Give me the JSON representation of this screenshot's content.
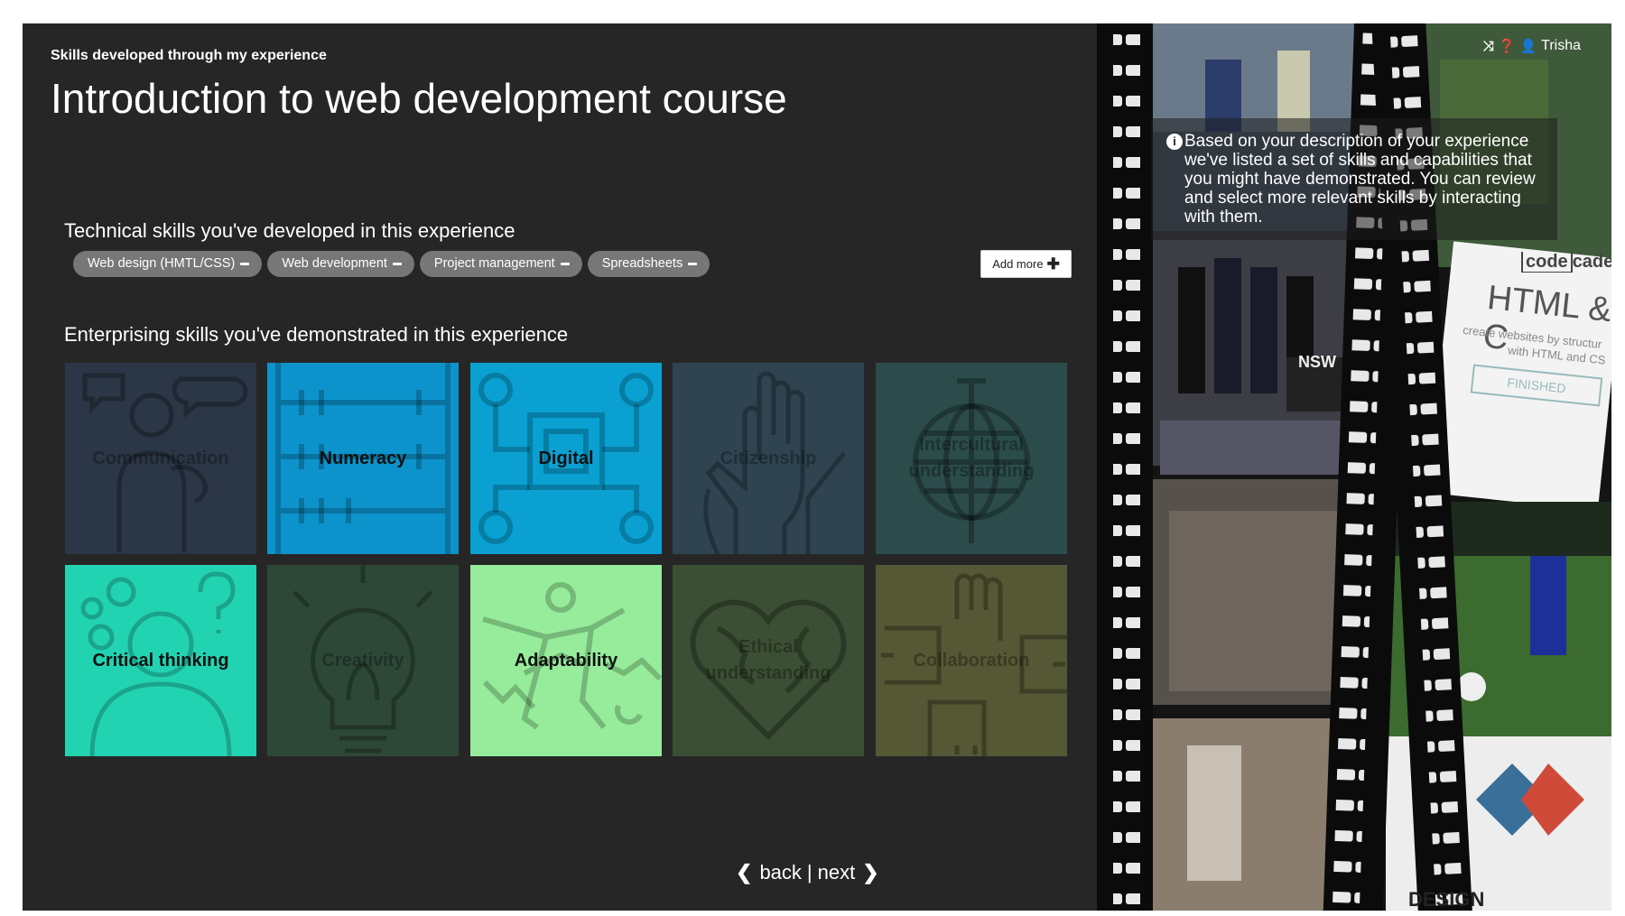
{
  "page": {
    "kicker": "Skills developed through my experience",
    "title": "Introduction to web development course"
  },
  "technical": {
    "heading": "Technical skills you've developed in this experience",
    "chips": [
      {
        "label": "Web design (HMTL/CSS)"
      },
      {
        "label": "Web development"
      },
      {
        "label": "Project management"
      },
      {
        "label": "Spreadsheets"
      }
    ],
    "add_more_label": "Add more"
  },
  "enterprising": {
    "heading": "Enterprising skills you've demonstrated in this experience",
    "tiles": [
      {
        "label": "Communication",
        "selected": false,
        "color": "#2b3646",
        "art": "communication-illustration"
      },
      {
        "label": "Numeracy",
        "selected": true,
        "color": "#0d93cc",
        "art": "abacus-illustration"
      },
      {
        "label": "Digital",
        "selected": true,
        "color": "#0aa0d2",
        "art": "circuit-illustration"
      },
      {
        "label": "Citizenship",
        "selected": false,
        "color": "#2f4450",
        "art": "raised-hands-illustration"
      },
      {
        "label": "Intercultural understanding",
        "selected": false,
        "color": "#2b4c4b",
        "art": "globe-illustration"
      },
      {
        "label": "Critical thinking",
        "selected": true,
        "color": "#22d3b2",
        "art": "thinking-head-illustration"
      },
      {
        "label": "Creativity",
        "selected": false,
        "color": "#2e4838",
        "art": "lightbulb-illustration"
      },
      {
        "label": "Adaptability",
        "selected": true,
        "color": "#96ec9a",
        "art": "flexible-figure-illustration"
      },
      {
        "label": "Ethical understanding",
        "selected": false,
        "color": "#3b4f34",
        "art": "heart-globe-illustration"
      },
      {
        "label": "Collaboration",
        "selected": false,
        "color": "#555834",
        "art": "joined-hands-illustration"
      }
    ]
  },
  "nav": {
    "back": "back",
    "separator": "|",
    "next": "next"
  },
  "user": {
    "name": "Trisha"
  },
  "info": {
    "text": "Based on your description of your experience we've listed a set of skills and capabilities that you might have demonstrated. You can review and select more relevant skills by interacting with them."
  },
  "photos": {
    "badge_nsw": "NSW",
    "course_brand": "code",
    "course_brand_suffix": "cade",
    "course_title": "HTML & C",
    "course_sub1": "create websites by structur",
    "course_sub2": "with HTML and CS",
    "course_button": "FINISHED",
    "poster_text": "DESIGN",
    "icons": [
      "shuffle-icon",
      "help-icon",
      "user-icon",
      "info-icon"
    ]
  }
}
